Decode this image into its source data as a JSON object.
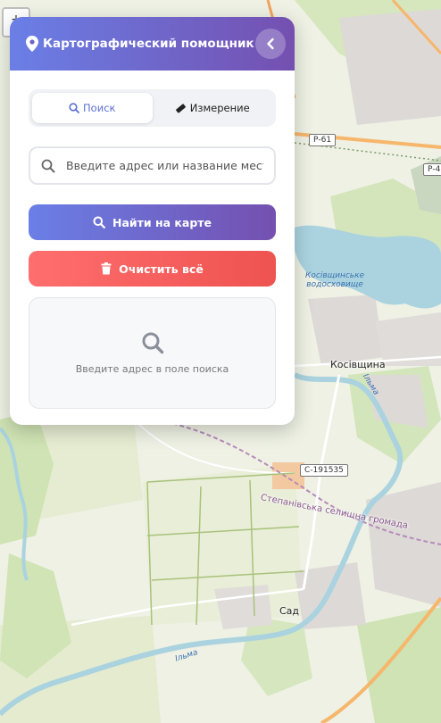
{
  "map": {
    "labels": {
      "road_r61": "Р-61",
      "road_r4": "Р-4",
      "road_c191535": "С-191535",
      "reservoir": "Косівщинське\nводосховище",
      "town_kosivshchyna": "Косівщина",
      "town_sad": "Сад",
      "river_ilma_1": "Ільма",
      "river_ilma_2": "Ільма",
      "admin_community": "Степанівська селищна громада"
    },
    "colors": {
      "land": "#eef1e4",
      "field": "#e6ecd2",
      "forest": "#cfe3b4",
      "water": "#aad3df",
      "urban": "#ddd9d6",
      "road_major": "#f6b66b",
      "road_minor": "#ffffff",
      "admin": "#b58bb9"
    }
  },
  "corner_button": {
    "label": "+"
  },
  "panel": {
    "title": "Картографический помощник",
    "icons": {
      "title": "map-pin-icon",
      "collapse": "chevron-left-icon"
    },
    "tabs": [
      {
        "label": "Поиск",
        "icon": "search-icon",
        "active": true
      },
      {
        "label": "Измерение",
        "icon": "ruler-icon",
        "active": false
      }
    ],
    "search": {
      "placeholder": "Введите адрес или название мест",
      "value": ""
    },
    "find_button": {
      "label": "Найти на карте",
      "icon": "search-icon"
    },
    "clear_button": {
      "label": "Очистить всё",
      "icon": "trash-icon"
    },
    "results": {
      "hint": "Введите адрес в поле поиска",
      "icon": "search-icon"
    },
    "colors": {
      "gradient_start": "#6a7fe6",
      "gradient_end": "#7450b0",
      "danger_start": "#ff6e6e",
      "danger_end": "#ee5350",
      "active_tab_text": "#5a6fd0"
    }
  }
}
